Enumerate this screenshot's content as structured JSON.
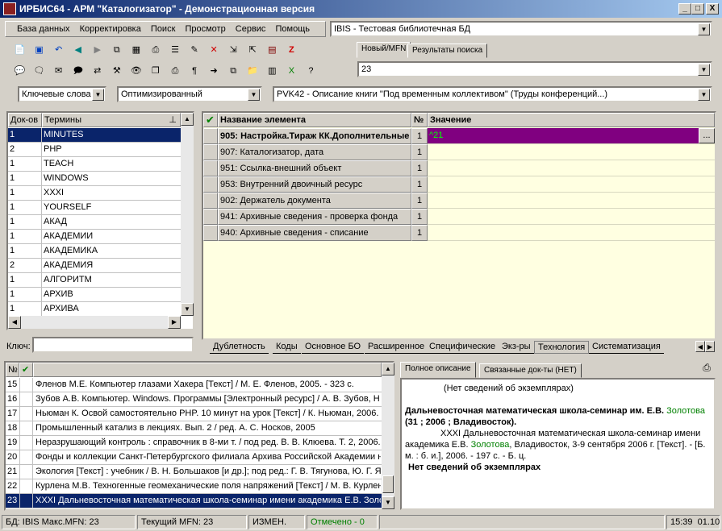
{
  "window": {
    "title": "ИРБИС64 - АРМ \"Каталогизатор\" - Демонстрационная версия",
    "btn_min": "_",
    "btn_max": "□",
    "btn_close": "X"
  },
  "menu": [
    "База данных",
    "Корректировка",
    "Поиск",
    "Просмотр",
    "Сервис",
    "Помощь"
  ],
  "database_select": "IBIS - Тестовая библиотечная БД",
  "mfn_tabs": [
    "Новый/MFN",
    "Результаты поиска"
  ],
  "mfn_value": "23",
  "toolbar2": {
    "search_mode": "Ключевые слова",
    "optimization": "Оптимизированный",
    "worksheet": "PVK42 - Описание книги \"Под временным коллективом\" (Труды конференций...)"
  },
  "terms": {
    "col_count": "Док-ов",
    "col_term": "Термины",
    "rows": [
      {
        "count": "1",
        "term": "MINUTES"
      },
      {
        "count": "2",
        "term": "PHP"
      },
      {
        "count": "1",
        "term": "TEACH"
      },
      {
        "count": "1",
        "term": "WINDOWS"
      },
      {
        "count": "1",
        "term": "XXXI"
      },
      {
        "count": "1",
        "term": "YOURSELF"
      },
      {
        "count": "1",
        "term": "АКАД"
      },
      {
        "count": "1",
        "term": "АКАДЕМИИ"
      },
      {
        "count": "1",
        "term": "АКАДЕМИКА"
      },
      {
        "count": "2",
        "term": "АКАДЕМИЯ"
      },
      {
        "count": "1",
        "term": "АЛГОРИТМ"
      },
      {
        "count": "1",
        "term": "АРХИВ"
      },
      {
        "count": "1",
        "term": "АРХИВА"
      }
    ],
    "key_label": "Ключ:",
    "key_value": ""
  },
  "editor": {
    "col_name": "Название элемента",
    "col_num": "№",
    "col_value": "Значение",
    "rows": [
      {
        "name": "905: Настройка.Тираж КК.Дополнительные",
        "num": "1",
        "value": "^21"
      },
      {
        "name": "907: Каталогизатор, дата",
        "num": "1",
        "value": ""
      },
      {
        "name": "951: Ссылка-внешний объект",
        "num": "1",
        "value": ""
      },
      {
        "name": "953: Внутренний двоичный ресурс",
        "num": "1",
        "value": ""
      },
      {
        "name": "902: Держатель документа",
        "num": "1",
        "value": ""
      },
      {
        "name": "941: Архивные сведения - проверка фонда",
        "num": "1",
        "value": ""
      },
      {
        "name": "940: Архивные сведения - списание",
        "num": "1",
        "value": ""
      }
    ],
    "ellipsis": "...",
    "tabs": [
      "Дублетность",
      "Коды",
      "Основное БО",
      "Расширенное",
      "Специфические",
      "Экз-ры",
      "Технология",
      "Систематизация"
    ]
  },
  "results": {
    "col_num": "№",
    "rows": [
      {
        "n": "15",
        "text": "Фленов М.Е. Компьютер глазами Хакера [Текст] / М. Е. Фленов, 2005. - 323 с."
      },
      {
        "n": "16",
        "text": "Зубов А.В. Компьютер. Windows. Программы [Электронный ресурс] / А. В. Зубов, Н"
      },
      {
        "n": "17",
        "text": "Ньюман К. Освой самостоятельно PHP. 10 минут на урок [Текст] / К. Ньюман, 2006."
      },
      {
        "n": "18",
        "text": "Промышленный катализ в лекциях. Вып. 2 / ред. А. С. Носков, 2005"
      },
      {
        "n": "19",
        "text": "Неразрушающий контроль : справочник в 8-ми т. / под ред. В. В. Клюева. Т. 2, 2006."
      },
      {
        "n": "20",
        "text": "Фонды и коллекции Санкт-Петербургского филиала Архива Российской Академии н"
      },
      {
        "n": "21",
        "text": "Экология [Текст] : учебник / В. Н. Большаков [и др.]; под ред.: Г. В. Тягунова, Ю. Г. Я"
      },
      {
        "n": "22",
        "text": "Курлена М.В. Техногенные геомеханические поля напряжений [Текст] / М. В. Курлен"
      },
      {
        "n": "23",
        "text": "XXXI Дальневосточная математическая школа-семинар имени академика Е.В. Золо"
      }
    ]
  },
  "description": {
    "tabs": [
      "Полное описание",
      "Связанные док-ты (НЕТ)"
    ],
    "line1": "(Нет сведений об экземплярах)",
    "heading_a": "Дальневосточная математическая школа-семинар им. Е.В. ",
    "heading_green": "Золотова",
    "heading_b": "(31 ; 2006 ; Владивосток).",
    "body_a": "XXXI Дальневосточная математическая школа-семинар имени академика Е.В. ",
    "body_green": "Золотова",
    "body_b": ", Владивосток, 3-9 сентября 2006 г. [Текст]. - [Б. м. : б. и.], 2006. - 197 с. - Б. ц.",
    "line_last": "Нет сведений об экземплярах"
  },
  "status": {
    "db": "БД: IBIS Макс.MFN: 23",
    "current": "Текущий MFN: 23",
    "changed": "ИЗМЕН.",
    "marked": "Отмечено - 0",
    "time": "15:39",
    "date": "01.10"
  },
  "colors": {
    "selection": "#0a246a",
    "edit_purple": "#800080",
    "value_bg": "#ffffe1",
    "marked_green": "#008000"
  }
}
